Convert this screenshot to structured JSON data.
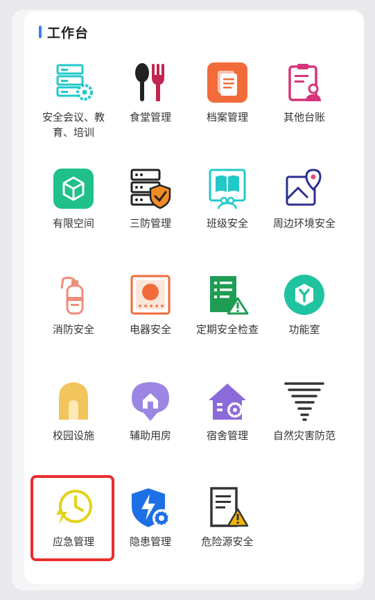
{
  "section": {
    "title": "工作台"
  },
  "tiles": [
    {
      "label": "安全会议、教育、培训",
      "icon": "server-gear-icon"
    },
    {
      "label": "食堂管理",
      "icon": "spoon-fork-icon"
    },
    {
      "label": "档案管理",
      "icon": "documents-icon"
    },
    {
      "label": "其他台账",
      "icon": "clipboard-user-icon"
    },
    {
      "label": "有限空间",
      "icon": "cube-icon"
    },
    {
      "label": "三防管理",
      "icon": "server-shield-icon"
    },
    {
      "label": "班级安全",
      "icon": "book-people-icon"
    },
    {
      "label": "周边环境安全",
      "icon": "map-pin-icon"
    },
    {
      "label": "消防安全",
      "icon": "fire-extinguisher-icon"
    },
    {
      "label": "电器安全",
      "icon": "appliance-icon"
    },
    {
      "label": "定期安全检查",
      "icon": "checklist-warning-icon"
    },
    {
      "label": "功能室",
      "icon": "hexagon-y-icon"
    },
    {
      "label": "校园设施",
      "icon": "campus-house-icon"
    },
    {
      "label": "辅助用房",
      "icon": "house-pin-icon"
    },
    {
      "label": "宿舍管理",
      "icon": "dorm-gear-icon"
    },
    {
      "label": "自然灾害防范",
      "icon": "tornado-icon"
    },
    {
      "label": "应急管理",
      "icon": "emergency-clock-icon"
    },
    {
      "label": "隐患管理",
      "icon": "shield-bolt-gear-icon"
    },
    {
      "label": "危险源安全",
      "icon": "document-warning-icon"
    }
  ],
  "highlighted_tile": "应急管理",
  "colors": {
    "accent": "#3b7bf6",
    "highlight": "#ec2c2c",
    "teal": "#22c9c9",
    "green": "#20c08a",
    "orange": "#f26b3a",
    "pink": "#d6337a",
    "gold": "#f2c45c",
    "purple": "#8b6ad9",
    "blue": "#1d6fe6"
  }
}
